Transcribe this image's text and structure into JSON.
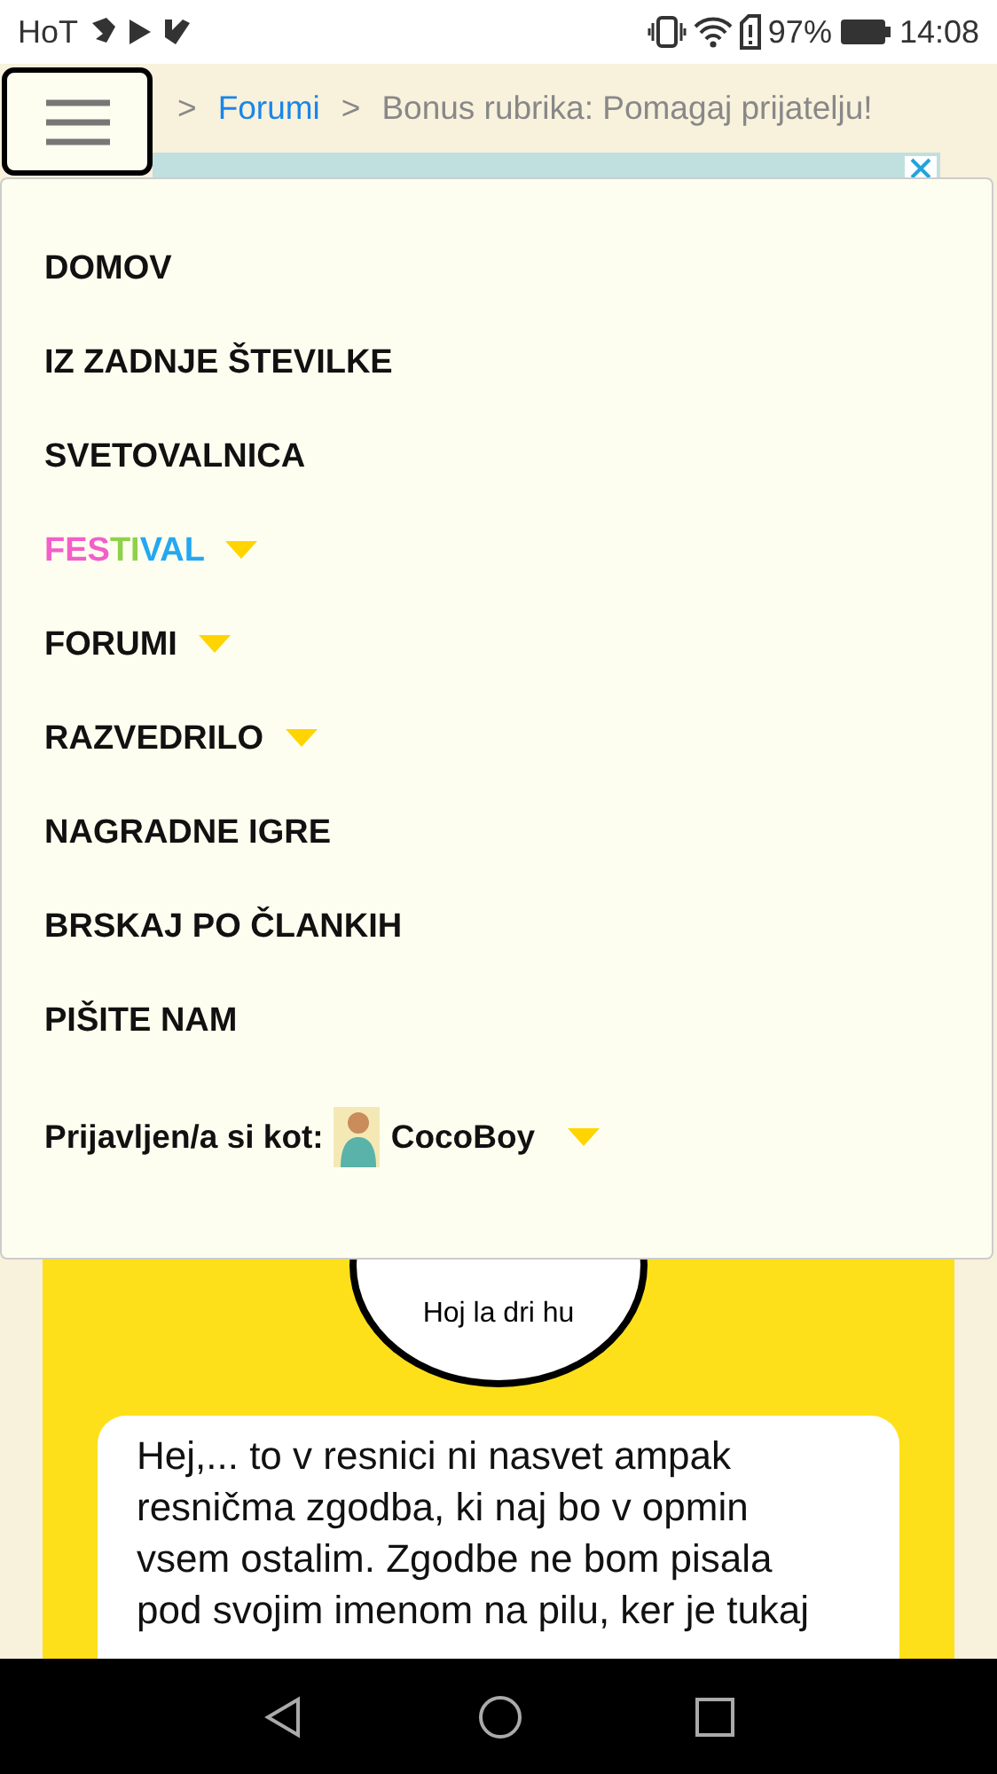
{
  "status_bar": {
    "carrier": "HoT",
    "battery": "97%",
    "time": "14:08"
  },
  "breadcrumb": {
    "separator_1": ">",
    "link": "Forumi",
    "separator_2": ">",
    "current": "Bonus rubrika: Pomagaj prijatelju!"
  },
  "menu": {
    "items": [
      {
        "label_parts": [
          {
            "text": "DOMOV"
          }
        ],
        "has_dropdown": false
      },
      {
        "label_parts": [
          {
            "text": "IZ ZADNJE ŠTEVILKE"
          }
        ],
        "has_dropdown": false
      },
      {
        "label_parts": [
          {
            "text": "SVETOVALNICA"
          }
        ],
        "has_dropdown": false
      },
      {
        "label_parts": [
          {
            "text": "FES",
            "color": "#f25fc9"
          },
          {
            "text": "TI",
            "color": "#8fd14b"
          },
          {
            "text": "VAL",
            "color": "#23a8f2"
          }
        ],
        "has_dropdown": true
      },
      {
        "label_parts": [
          {
            "text": "FORUMI"
          }
        ],
        "has_dropdown": true
      },
      {
        "label_parts": [
          {
            "text": "RAZVEDRILO"
          }
        ],
        "has_dropdown": true
      },
      {
        "label_parts": [
          {
            "text": "NAGRADNE IGRE"
          }
        ],
        "has_dropdown": false
      },
      {
        "label_parts": [
          {
            "text": "BRSKAJ PO ČLANKIH"
          }
        ],
        "has_dropdown": false
      },
      {
        "label_parts": [
          {
            "text": "PIŠITE NAM"
          }
        ],
        "has_dropdown": false
      }
    ],
    "user": {
      "label": "Prijavljen/a si kot:",
      "username": "CocoBoy",
      "has_dropdown": true
    }
  },
  "post": {
    "author": "Hoj la dri hu",
    "text": "Hej,... to v resnici ni nasvet ampak resničma zgodba, ki naj bo v opmin vsem ostalim. Zgodbe ne bom pisala pod svojim imenom na pilu, ker je tukaj"
  }
}
